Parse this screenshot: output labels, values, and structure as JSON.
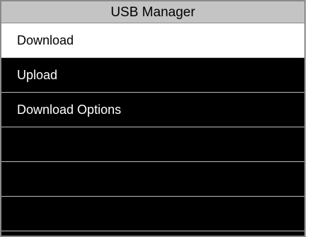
{
  "screen": {
    "title": "USB Manager"
  },
  "menu": {
    "selected_index": 0,
    "items": [
      {
        "label": "Download"
      },
      {
        "label": "Upload"
      },
      {
        "label": "Download Options"
      },
      {
        "label": ""
      },
      {
        "label": ""
      },
      {
        "label": ""
      }
    ]
  },
  "colors": {
    "title_bar_bg": "#c4c4c4",
    "screen_bg": "#000000",
    "selected_bg": "#ffffff",
    "text_light": "#ffffff",
    "text_dark": "#000000",
    "divider": "#bdbdbd"
  }
}
